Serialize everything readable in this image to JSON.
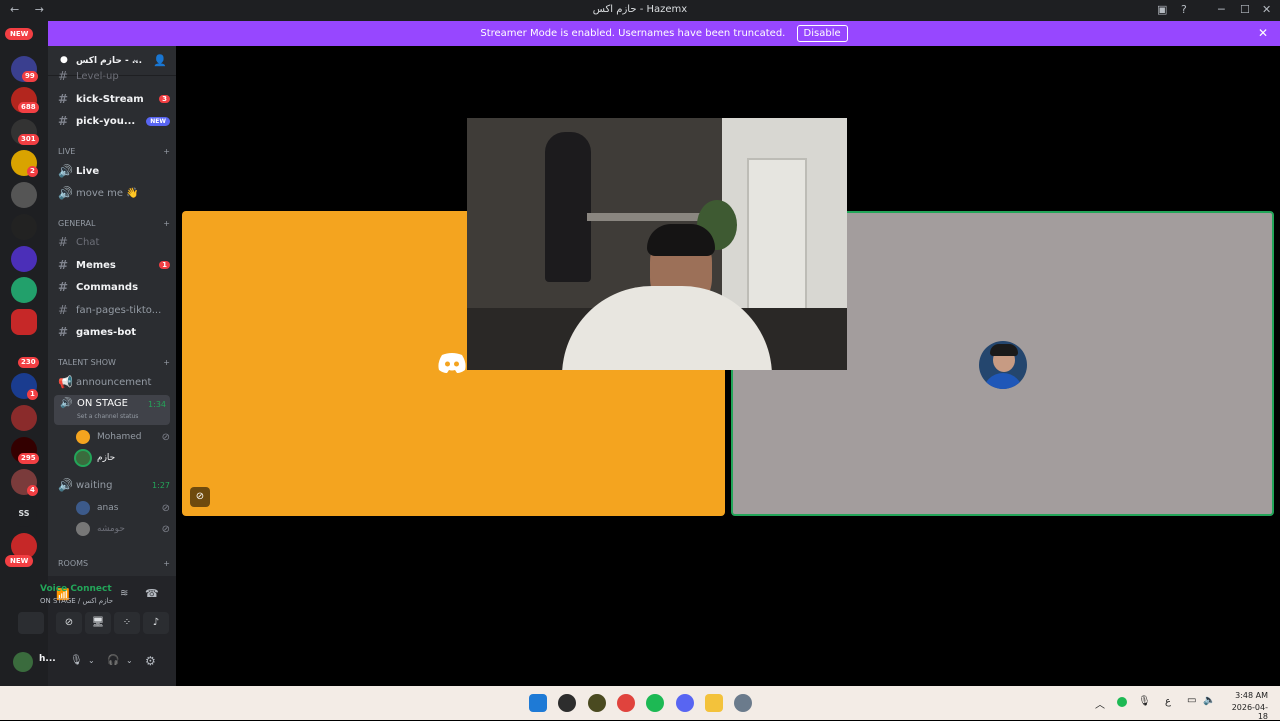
{
  "window": {
    "title": "حازم اكس - Hazemx",
    "nav": "← →",
    "controls": [
      "▣",
      "?",
      "─",
      "☐",
      "✕"
    ]
  },
  "banner": {
    "text": "Streamer Mode is enabled. Usernames have been truncated.",
    "action": "Disable"
  },
  "guilds": {
    "new_top": "NEW",
    "new_bottom": "NEW",
    "badges": [
      "14",
      "99",
      "688",
      "301",
      "2",
      "230",
      "1",
      "295",
      "4"
    ],
    "text_server": "SS"
  },
  "server": {
    "name": "حازم اكس - ..."
  },
  "channels": [
    {
      "name": "Level-up",
      "unread": false
    },
    {
      "name": "kick-Stream",
      "unread": true,
      "count": "3"
    },
    {
      "name": "pick-you...",
      "unread": true,
      "pill": "NEW"
    }
  ],
  "categories": {
    "live": "LIVE",
    "general": "general",
    "talent": "TALENT SHOW",
    "rooms": "ROOMS"
  },
  "live_channels": [
    "Live",
    "move me 👋"
  ],
  "general_channels": [
    {
      "name": "Chat",
      "unread": false
    },
    {
      "name": "Memes",
      "unread": true,
      "count": "1"
    },
    {
      "name": "Commands",
      "unread": true
    },
    {
      "name": "fan-pages-tikto...",
      "unread": false
    },
    {
      "name": "games-bot",
      "unread": true
    }
  ],
  "talent": {
    "announcement": "announcement",
    "on_stage": {
      "name": "ON STAGE",
      "time": "1:34",
      "status": "Set a channel status"
    },
    "on_stage_users": [
      "Mohamed",
      "حازم"
    ],
    "waiting": {
      "name": "waiting",
      "time": "1:27"
    },
    "waiting_users": [
      "anas",
      "حومشه"
    ]
  },
  "voice": {
    "status": "Voice Connected",
    "channel": "ON STAGE / حازم اكس"
  },
  "user": {
    "name": "h..."
  },
  "taskbar": {
    "time": "3:48 AM",
    "date": "2026-04-18",
    "lang": "ع"
  },
  "colors": {
    "accent": "#9747ff",
    "tile_left": "#f4a41f",
    "tile_right": "#a39d9d",
    "speaking": "#23a559",
    "unread_badge": "#f23f43"
  }
}
